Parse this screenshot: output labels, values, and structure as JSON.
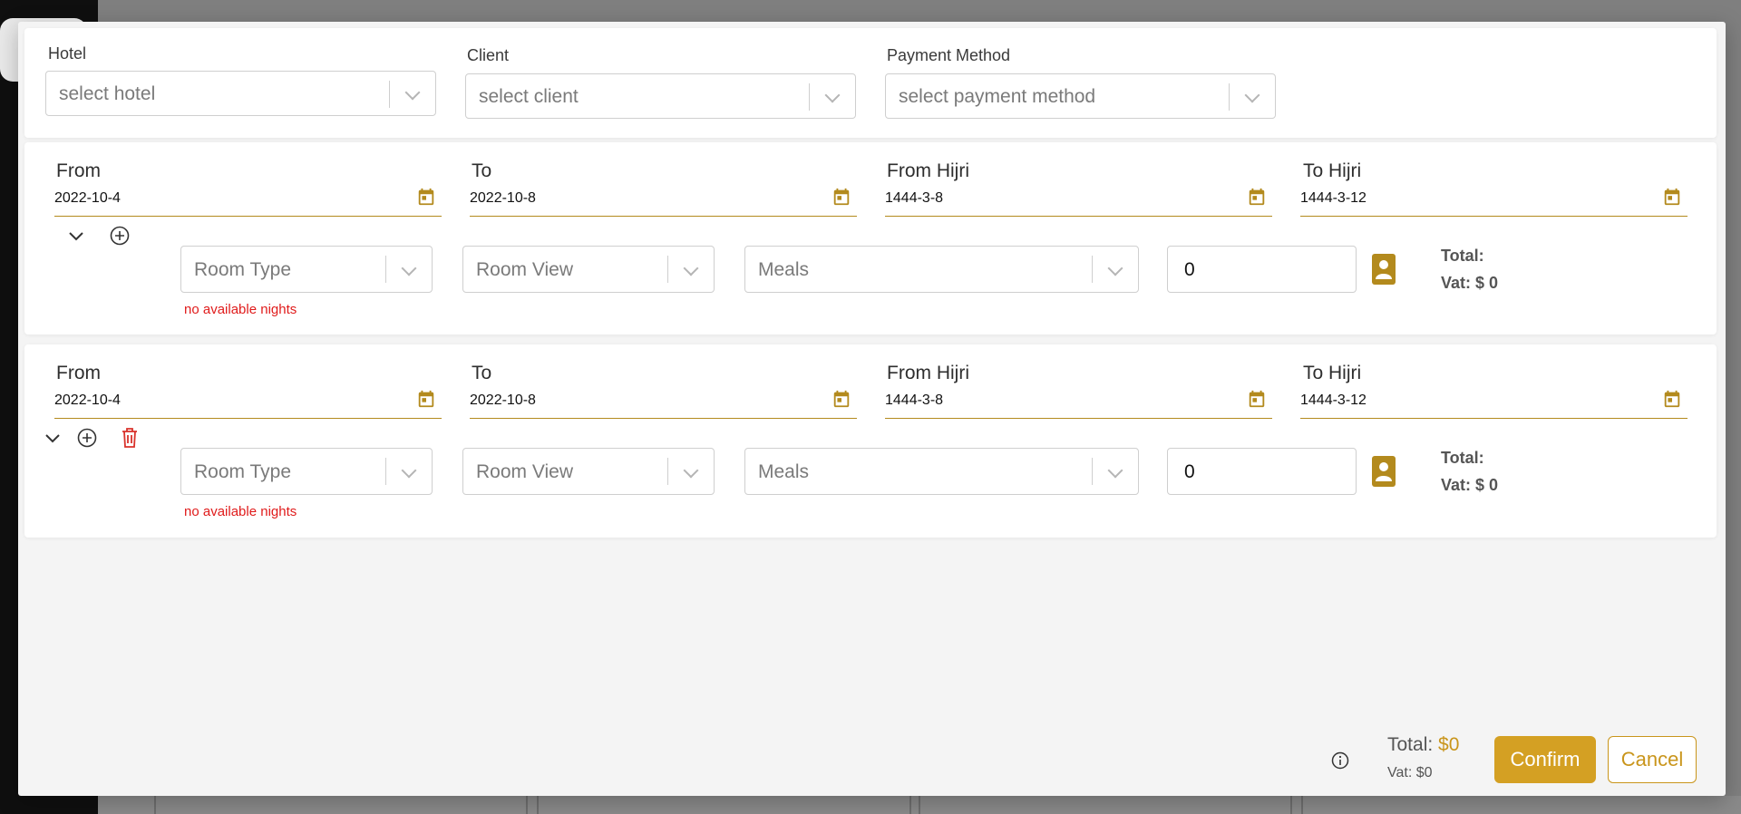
{
  "header": {
    "hotel": {
      "label": "Hotel",
      "placeholder": "select hotel"
    },
    "client": {
      "label": "Client",
      "placeholder": "select client"
    },
    "payment": {
      "label": "Payment Method",
      "placeholder": "select payment method"
    }
  },
  "rows": [
    {
      "from_label": "From",
      "from_value": "2022-10-4",
      "to_label": "To",
      "to_value": "2022-10-8",
      "from_hijri_label": "From Hijri",
      "from_hijri_value": "1444-3-8",
      "to_hijri_label": "To Hijri",
      "to_hijri_value": "1444-3-12",
      "room_type": "Room Type",
      "room_view": "Room View",
      "meals": "Meals",
      "quantity": "0",
      "total_label": "Total:",
      "vat_label": "Vat: $ 0",
      "error": "no available nights"
    },
    {
      "from_label": "From",
      "from_value": "2022-10-4",
      "to_label": "To",
      "to_value": "2022-10-8",
      "from_hijri_label": "From Hijri",
      "from_hijri_value": "1444-3-8",
      "to_hijri_label": "To Hijri",
      "to_hijri_value": "1444-3-12",
      "room_type": "Room Type",
      "room_view": "Room View",
      "meals": "Meals",
      "quantity": "0",
      "total_label": "Total:",
      "vat_label": "Vat: $ 0",
      "error": "no available nights"
    }
  ],
  "footer": {
    "total_label": "Total: ",
    "total_amount": "$0",
    "vat": "Vat: $0",
    "confirm": "Confirm",
    "cancel": "Cancel"
  },
  "colors": {
    "accent": "#c9951b",
    "error": "#e01b1b",
    "delete": "#d9322b"
  },
  "icons": [
    "calendar-icon",
    "chevron-down-icon",
    "add-circle-icon",
    "trash-icon",
    "guest-icon",
    "info-icon"
  ]
}
